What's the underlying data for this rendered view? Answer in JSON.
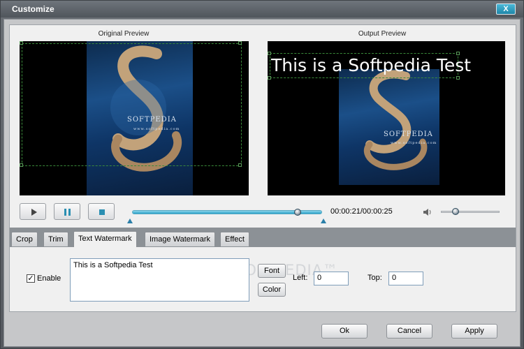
{
  "window": {
    "title": "Customize",
    "close_label": "X"
  },
  "previews": {
    "original_label": "Original Preview",
    "output_label": "Output Preview",
    "logo_text": "SOFTPEDIA",
    "logo_url": "www.softpedia.com"
  },
  "playback": {
    "time": "00:00:21/00:00:25",
    "progress": 0.87,
    "volume": 0.25,
    "buttons": [
      "play-icon",
      "pause-icon",
      "stop-icon"
    ]
  },
  "tabs": [
    "Crop",
    "Trim",
    "Text Watermark",
    "Image Watermark",
    "Effect"
  ],
  "active_tab": "Text Watermark",
  "watermark": {
    "enable_label": "Enable",
    "enabled": true,
    "text": "This is a Softpedia Test",
    "font_label": "Font",
    "color_label": "Color",
    "left_label": "Left:",
    "left_value": "0",
    "top_label": "Top:",
    "top_value": "0",
    "background_brand": "SOFTPEDIA™"
  },
  "actions": {
    "ok": "Ok",
    "cancel": "Cancel",
    "apply": "Apply"
  },
  "colors": {
    "accent": "#2aa2c8",
    "crop": "#3a8a3a"
  }
}
